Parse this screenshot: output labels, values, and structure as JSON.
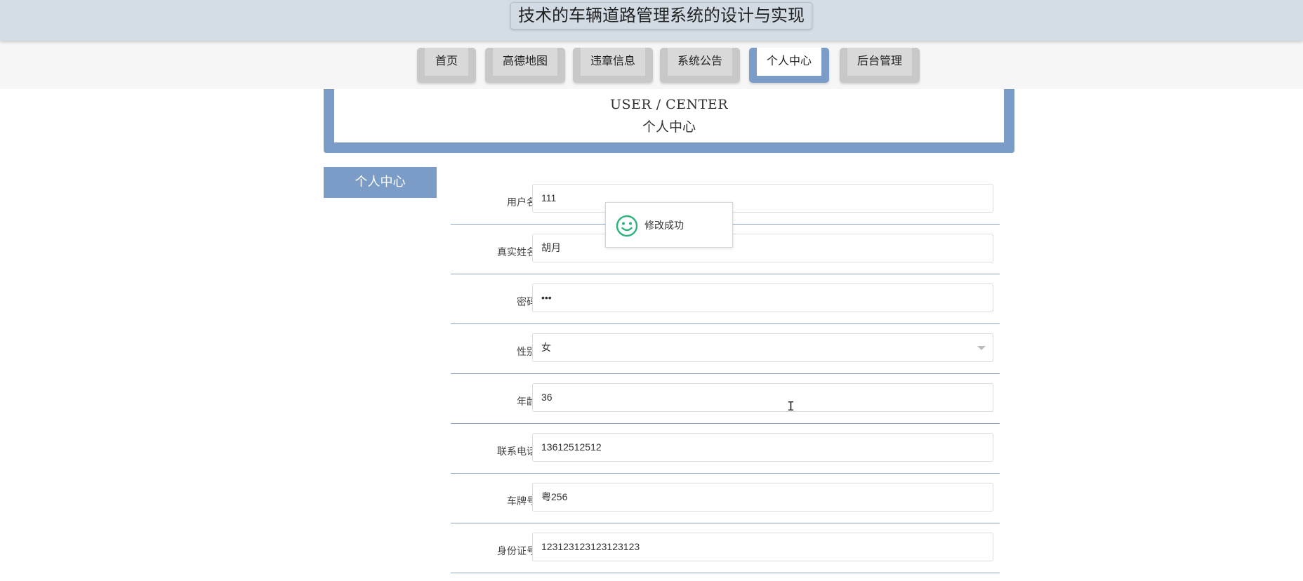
{
  "app": {
    "title": "技术的车辆道路管理系统的设计与实现"
  },
  "nav": {
    "tabs": [
      {
        "label": "首页",
        "active": false
      },
      {
        "label": "高德地图",
        "active": false
      },
      {
        "label": "违章信息",
        "active": false
      },
      {
        "label": "系统公告",
        "active": false
      },
      {
        "label": "个人中心",
        "active": true
      },
      {
        "label": "后台管理",
        "active": false
      }
    ]
  },
  "header": {
    "en": "USER / CENTER",
    "cn": "个人中心"
  },
  "sidebar": {
    "items": [
      {
        "label": "个人中心"
      }
    ]
  },
  "form": {
    "fields": [
      {
        "label": "用户名",
        "value": "111",
        "type": "text"
      },
      {
        "label": "真实姓名",
        "value": "胡月",
        "type": "text"
      },
      {
        "label": "密码",
        "value": "•••",
        "type": "password"
      },
      {
        "label": "性别",
        "value": "女",
        "type": "select"
      },
      {
        "label": "年龄",
        "value": "36",
        "type": "text"
      },
      {
        "label": "联系电话",
        "value": "13612512512",
        "type": "text"
      },
      {
        "label": "车牌号",
        "value": "粤256",
        "type": "text"
      },
      {
        "label": "身份证号",
        "value": "123123123123123123",
        "type": "text"
      }
    ]
  },
  "toast": {
    "message": "修改成功",
    "icon": "smiley-icon",
    "color": "#2bb37a"
  },
  "colors": {
    "accent": "#7a9cc6",
    "title_bar": "#d4dde6"
  }
}
